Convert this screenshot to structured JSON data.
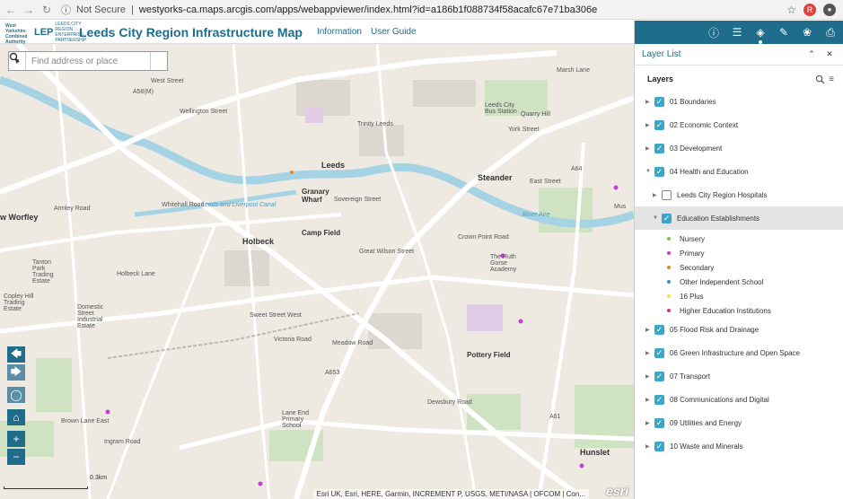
{
  "browser": {
    "security": "Not Secure",
    "url": "westyorks-ca.maps.arcgis.com/apps/webappviewer/index.html?id=a186b1f088734f58acafc67e71ba306e",
    "avatar_letter": "R"
  },
  "header": {
    "logo1_text": "West Yorkshire Combined Authority",
    "logo2_mark": "LEP",
    "logo2_text": "LEEDS CITY REGION ENTERPRISE PARTNERSHIP",
    "title": "Leeds City Region Infrastructure Map",
    "links": [
      "Information",
      "User Guide"
    ]
  },
  "search": {
    "placeholder": "Find address or place"
  },
  "map": {
    "scale": "0.3km",
    "attribution": "Esri UK, Esri, HERE, Garmin, INCREMENT P, USGS, METI/NASA | OFCOM | Con...",
    "esri_logo": "esri",
    "labels": [
      "West Street",
      "A58(M)",
      "Wellington Street",
      "Trinity Leeds",
      "Quarry Hill",
      "Leeds City Bus Station",
      "York Street",
      "Leeds",
      "Steander",
      "Granary Wharf",
      "Leeds and Liverpool Canal",
      "Sovereign Street",
      "River Aire",
      "Holbeck",
      "Camp Field",
      "Great Wilson Street",
      "The Ruth Gorse Academy",
      "Whitehall Road",
      "Holbeck Lane",
      "Domestic Street Industrial Estate",
      "Sweet Street West",
      "Victoria Road",
      "Pottery Field",
      "Lane End Primary School",
      "Hunslet",
      "Brown Lane East",
      "Ingram Road",
      "Copley Hill Trading Estate",
      "Tanton Park Trading Estate",
      "Armley Road",
      "w Worfley",
      "Dewsbury Road",
      "Meadow Road",
      "A653",
      "A61",
      "East Street",
      "A64",
      "Crown Point Road",
      "Marsh Lane",
      "Mus"
    ]
  },
  "panel": {
    "title": "Layer List",
    "section_title": "Layers",
    "layers": [
      {
        "label": "01 Boundaries",
        "checked": true
      },
      {
        "label": "02 Economic Context",
        "checked": true
      },
      {
        "label": "03 Development",
        "checked": true
      },
      {
        "label": "04 Health and Education",
        "checked": true,
        "expanded": true
      },
      {
        "label": "Leeds City Region Hospitals",
        "checked": false,
        "sub": true
      },
      {
        "label": "Education Establishments",
        "checked": true,
        "sub": true,
        "expanded": true
      },
      {
        "label": "05 Flood Risk and Drainage",
        "checked": true
      },
      {
        "label": "06 Green Infrastructure and Open Space",
        "checked": true
      },
      {
        "label": "07 Transport",
        "checked": true
      },
      {
        "label": "08 Communications and Digital",
        "checked": true
      },
      {
        "label": "09 Utilities and Energy",
        "checked": true
      },
      {
        "label": "10 Waste and Minerals",
        "checked": true
      }
    ],
    "legend": [
      {
        "label": "Nursery",
        "color": "#7cc34d"
      },
      {
        "label": "Primary",
        "color": "#c23fd0"
      },
      {
        "label": "Secondary",
        "color": "#e28a2b"
      },
      {
        "label": "Other Independent School",
        "color": "#3a8ed3"
      },
      {
        "label": "16 Plus",
        "color": "#f0e04a"
      },
      {
        "label": "Higher Education Institutions",
        "color": "#d0367a"
      }
    ]
  },
  "colors": {
    "brand": "#1f6c8b",
    "checkbox": "#3aa6c9",
    "map_bg": "#eeeae2",
    "water": "#a6d3e4"
  }
}
